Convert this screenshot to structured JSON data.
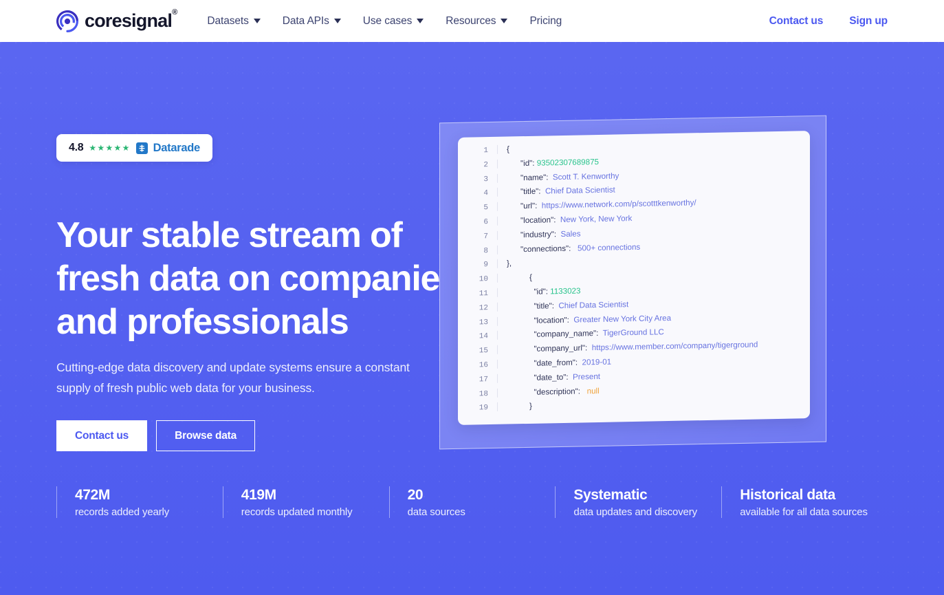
{
  "brand": {
    "name": "coresignal",
    "registered_mark": "®",
    "logo_icon": "target-circle-icon"
  },
  "nav": {
    "items": [
      {
        "label": "Datasets",
        "has_dropdown": true
      },
      {
        "label": "Data APIs",
        "has_dropdown": true
      },
      {
        "label": "Use cases",
        "has_dropdown": true
      },
      {
        "label": "Resources",
        "has_dropdown": true
      },
      {
        "label": "Pricing",
        "has_dropdown": false
      }
    ],
    "contact_label": "Contact us",
    "signup_label": "Sign up"
  },
  "hero": {
    "badge": {
      "score": "4.8",
      "stars": "★★★★★",
      "icon": "datarade-logo-icon",
      "brand": "Datarade"
    },
    "headline": "Your stable stream of fresh data on companies and professionals",
    "subheadline": "Cutting-edge data discovery and update systems ensure a constant supply of fresh public web data for your business.",
    "primary_cta": "Contact us",
    "secondary_cta": "Browse data"
  },
  "code_panel": {
    "lines": [
      {
        "n": "1",
        "indent": "ind1",
        "key": "{",
        "value": "",
        "vclass": "k"
      },
      {
        "n": "2",
        "indent": "ind2",
        "key": "\"id\": ",
        "value": "93502307689875",
        "vclass": "v-num"
      },
      {
        "n": "3",
        "indent": "ind2",
        "key": "\"name\":  ",
        "value": "Scott T. Kenworthy",
        "vclass": "v-str"
      },
      {
        "n": "4",
        "indent": "ind2",
        "key": "\"title\":  ",
        "value": "Chief Data Scientist",
        "vclass": "v-str"
      },
      {
        "n": "5",
        "indent": "ind2",
        "key": "\"url\":  ",
        "value": "https://www.network.com/p/scotttkenworthy/",
        "vclass": "v-str"
      },
      {
        "n": "6",
        "indent": "ind2",
        "key": "\"location\":  ",
        "value": "New York, New York",
        "vclass": "v-str"
      },
      {
        "n": "7",
        "indent": "ind2",
        "key": "\"industry\":  ",
        "value": "Sales",
        "vclass": "v-str"
      },
      {
        "n": "8",
        "indent": "ind2",
        "key": "\"connections\":   ",
        "value": "500+ connections",
        "vclass": "v-str"
      },
      {
        "n": "9",
        "indent": "ind1",
        "key": "},",
        "value": "",
        "vclass": "k"
      },
      {
        "n": "10",
        "indent": "ind3",
        "key": "{",
        "value": "",
        "vclass": "k"
      },
      {
        "n": "11",
        "indent": "ind3",
        "key": "  \"id\": ",
        "value": "1133023",
        "vclass": "v-num"
      },
      {
        "n": "12",
        "indent": "ind3",
        "key": "  \"title\":  ",
        "value": "Chief Data Scientist",
        "vclass": "v-str"
      },
      {
        "n": "13",
        "indent": "ind3",
        "key": "  \"location\":  ",
        "value": "Greater New York City Area",
        "vclass": "v-str"
      },
      {
        "n": "14",
        "indent": "ind3",
        "key": "  \"company_name\":  ",
        "value": "TigerGround LLC",
        "vclass": "v-str"
      },
      {
        "n": "15",
        "indent": "ind3",
        "key": "  \"company_url\":  ",
        "value": "https://www.member.com/company/tigerground",
        "vclass": "v-str"
      },
      {
        "n": "16",
        "indent": "ind3",
        "key": "  \"date_from\":  ",
        "value": "2019-01",
        "vclass": "v-str"
      },
      {
        "n": "17",
        "indent": "ind3",
        "key": "  \"date_to\":  ",
        "value": "Present",
        "vclass": "v-str"
      },
      {
        "n": "18",
        "indent": "ind3",
        "key": "  \"description\":   ",
        "value": "null",
        "vclass": "v-null"
      },
      {
        "n": "19",
        "indent": "ind3",
        "key": "}",
        "value": "",
        "vclass": "k"
      }
    ]
  },
  "stats": [
    {
      "value": "472M",
      "label": "records added yearly"
    },
    {
      "value": "419M",
      "label": "records updated monthly"
    },
    {
      "value": "20",
      "label": "data sources"
    },
    {
      "value": "Systematic",
      "label": "data updates and discovery"
    },
    {
      "value": "Historical data",
      "label": "available for all data sources"
    }
  ],
  "colors": {
    "hero_background": "#5663f0",
    "brand_blue": "#4b58f0",
    "code_panel_outer": "#7a83f3",
    "code_card": "#f9f9fd",
    "json_number": "#27c38b",
    "json_string": "#6672e0",
    "json_null": "#f0a33c",
    "star_green": "#2bb673",
    "datarade_blue": "#2278c8"
  }
}
